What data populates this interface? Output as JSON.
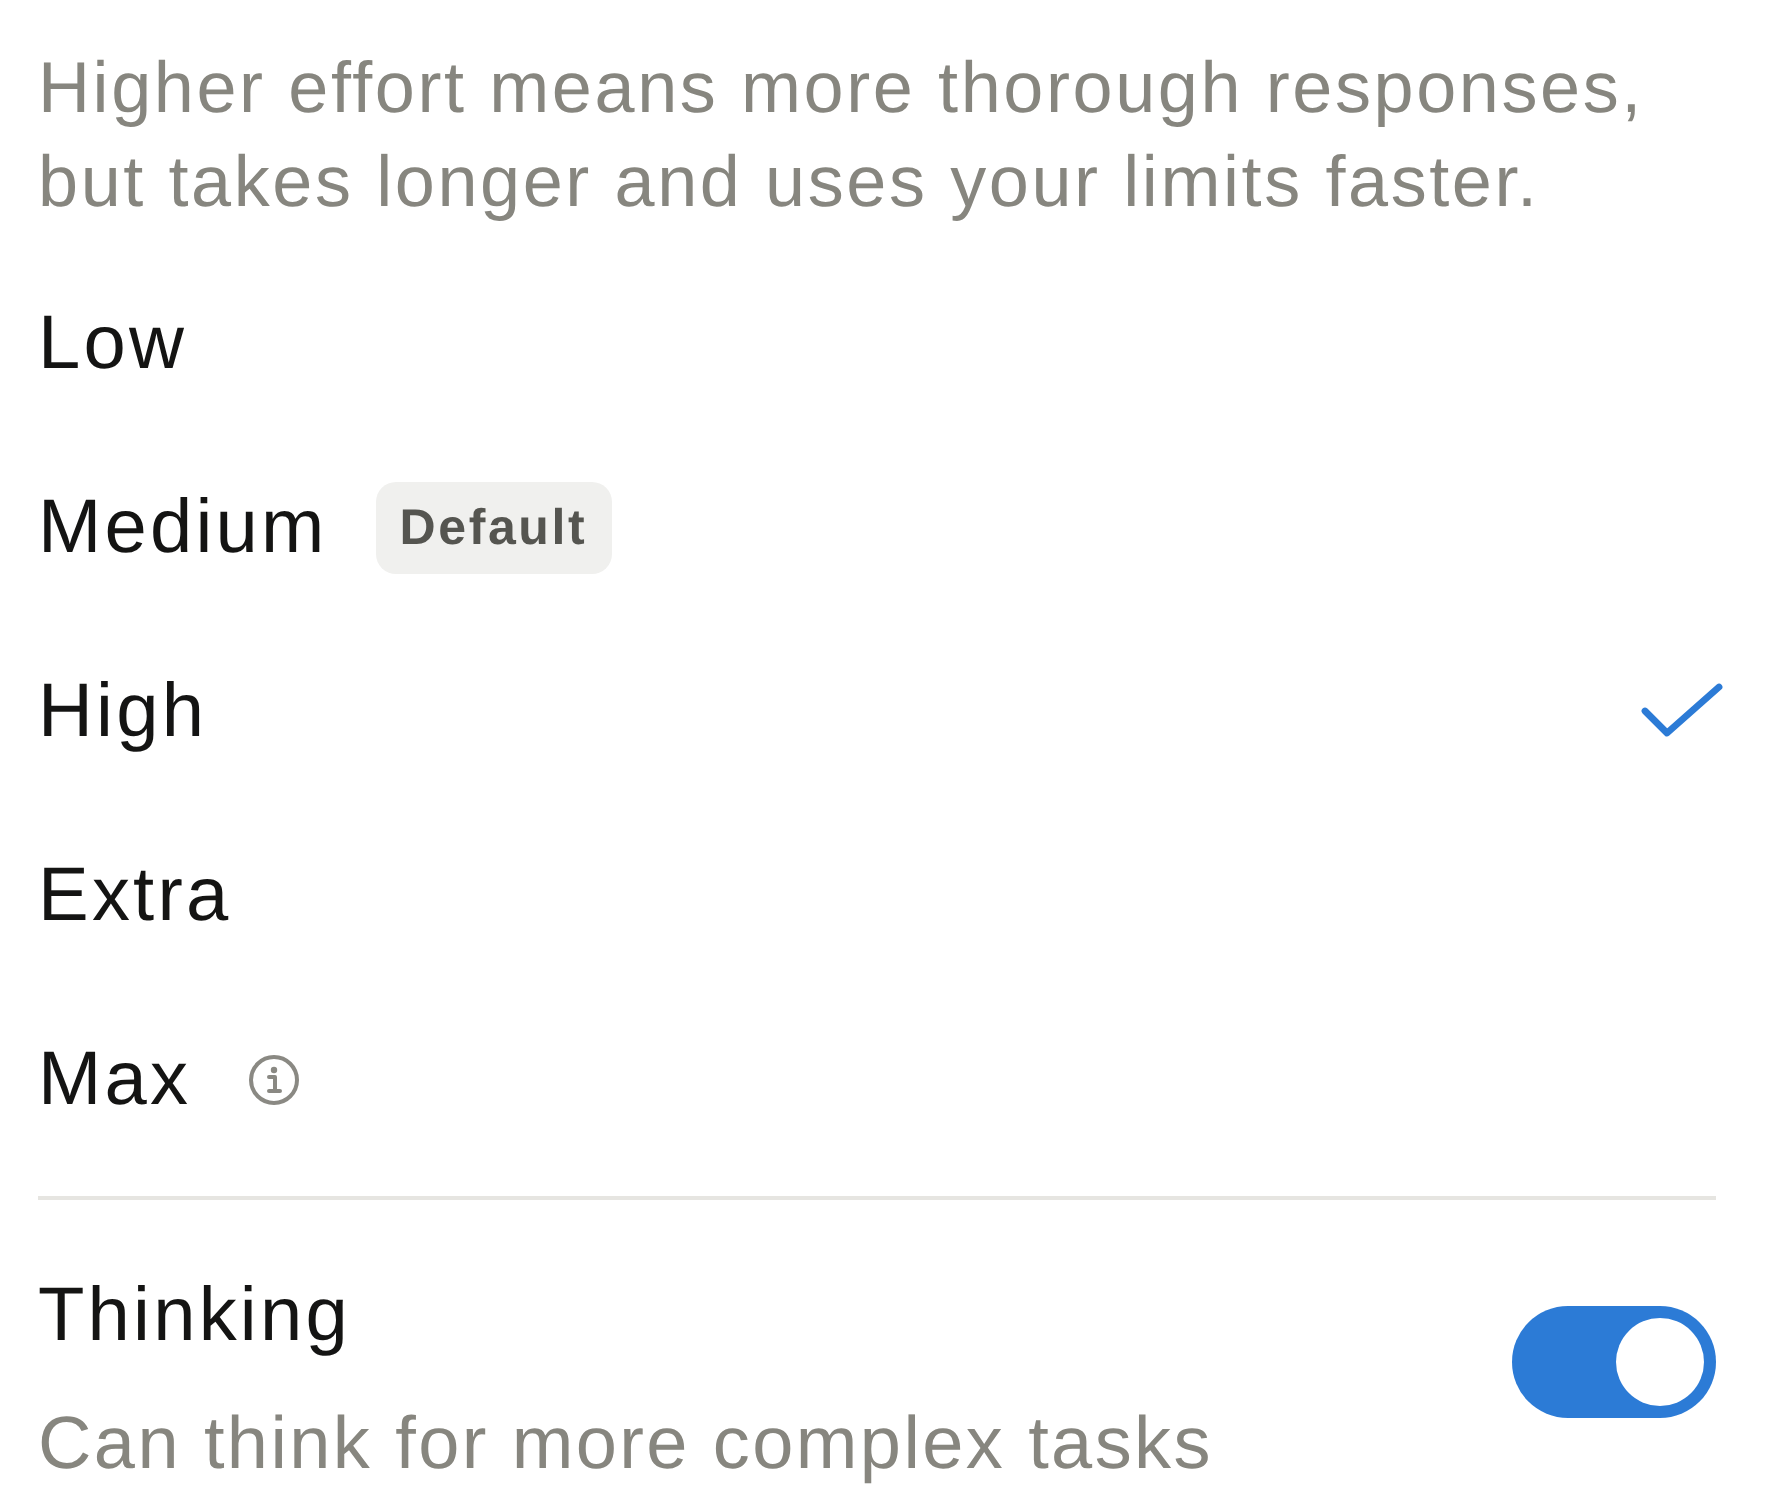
{
  "description": "Higher effort means more thorough responses, but takes longer and uses your limits faster.",
  "options": [
    {
      "label": "Low",
      "selected": false,
      "info": false
    },
    {
      "label": "Medium",
      "badge": "Default",
      "selected": false,
      "info": false
    },
    {
      "label": "High",
      "selected": true,
      "info": false
    },
    {
      "label": "Extra",
      "selected": false,
      "info": false
    },
    {
      "label": "Max",
      "selected": false,
      "info": true
    }
  ],
  "thinking": {
    "title": "Thinking",
    "subtitle": "Can think for more complex tasks",
    "on": true
  }
}
